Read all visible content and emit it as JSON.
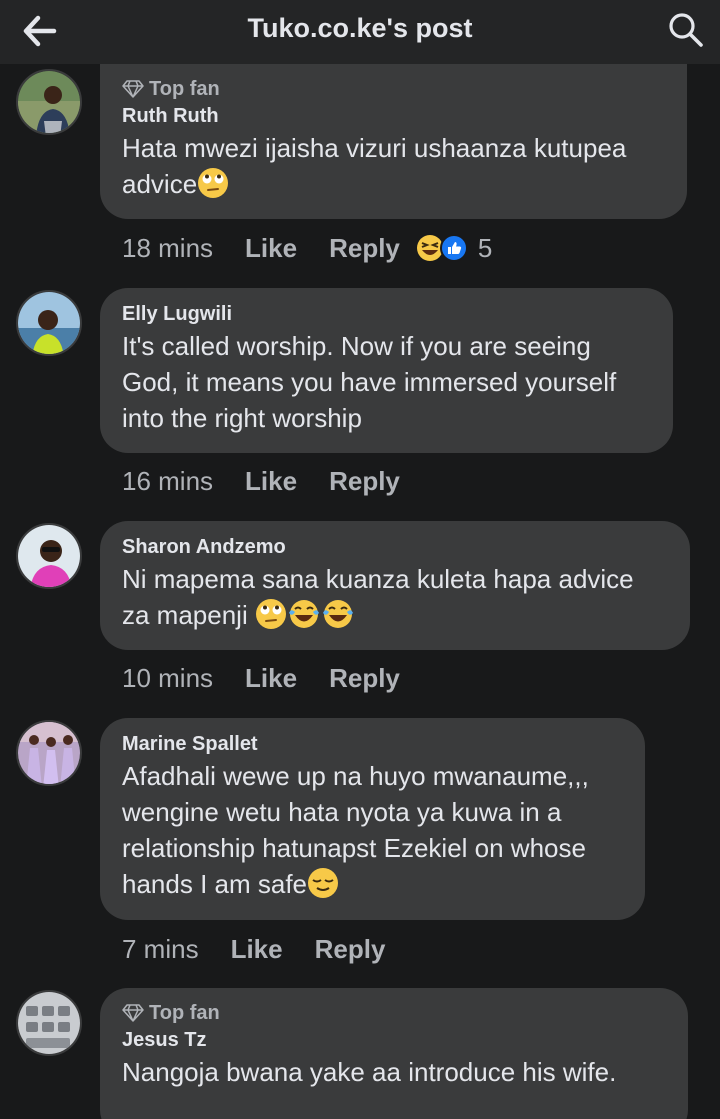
{
  "header": {
    "title": "Tuko.co.ke's post"
  },
  "comments": [
    {
      "badge": "Top fan",
      "author": "Ruth Ruth",
      "text": "Hata mwezi ijaisha vizuri ushaanza kutupea advice",
      "time": "18 mins",
      "like": "Like",
      "reply": "Reply",
      "reaction_count": "5"
    },
    {
      "author": "Elly Lugwili",
      "text": "It's called worship. Now if you are seeing God, it means you have immersed yourself into the right worship",
      "time": "16 mins",
      "like": "Like",
      "reply": "Reply"
    },
    {
      "author": "Sharon Andzemo",
      "text": "Ni mapema sana kuanza kuleta hapa advice za mapenji",
      "time": "10 mins",
      "like": "Like",
      "reply": "Reply"
    },
    {
      "author": "Marine Spallet",
      "text1": "Afadhali wewe up na huyo mwanaume,,,",
      "text2": "wengine wetu hata nyota ya kuwa in a",
      "text3": "relationship hatunapst Ezekiel on whose",
      "text4": "hands I am safe",
      "time": "7 mins",
      "like": "Like",
      "reply": "Reply"
    },
    {
      "badge": "Top fan",
      "author": "Jesus Tz",
      "text": "Nangoja bwana yake aa introduce his wife."
    }
  ],
  "icons": {
    "back": "arrow-left-icon",
    "search": "search-icon",
    "badge": "diamond-icon",
    "like_reaction": "thumbs-up-icon",
    "haha_reaction": "laughing-emoji-icon"
  },
  "colors": {
    "background": "#18191a",
    "bubble": "#3a3b3c",
    "header": "#242526",
    "like_blue": "#1877f2",
    "muted": "#b0b3b8"
  }
}
